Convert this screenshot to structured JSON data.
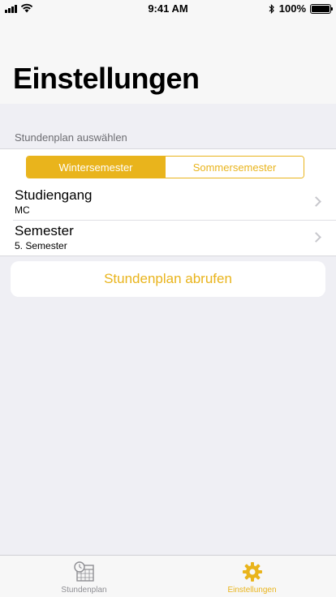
{
  "status_bar": {
    "time": "9:41 AM",
    "battery": "100%",
    "battery_level": 1.0
  },
  "header": {
    "title": "Einstellungen"
  },
  "section": {
    "header": "Stundenplan auswählen",
    "segments": [
      {
        "label": "Wintersemester",
        "selected": true
      },
      {
        "label": "Sommersemester",
        "selected": false
      }
    ],
    "rows": [
      {
        "title": "Studiengang",
        "subtitle": "MC"
      },
      {
        "title": "Semester",
        "subtitle": "5. Semester"
      }
    ]
  },
  "fetch_button": {
    "label": "Stundenplan abrufen"
  },
  "tab_bar": {
    "items": [
      {
        "label": "Stundenplan",
        "icon": "calendar-clock-icon",
        "active": false
      },
      {
        "label": "Einstellungen",
        "icon": "gear-icon",
        "active": true
      }
    ]
  },
  "colors": {
    "accent": "#e9b41c",
    "background": "#efeff4",
    "inactive": "#8e8e93"
  }
}
